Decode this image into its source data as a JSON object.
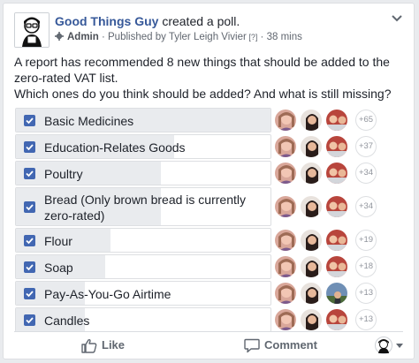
{
  "post": {
    "page_name": "Good Things Guy",
    "action": " created a poll.",
    "admin_label": "Admin",
    "published_text": " · Published by Tyler Leigh Vivier",
    "superscript": " [?]",
    "time": " · 38 mins",
    "text": "A report has recommended 8 new things that should be added to the zero-rated VAT list.\nWhich ones do you think should be added? And what is still missing?"
  },
  "poll": {
    "options": [
      {
        "label": "Basic Medicines",
        "more": "+65",
        "fill": 1.0,
        "checked": true
      },
      {
        "label": "Education-Relates Goods",
        "more": "+37",
        "fill": 0.62,
        "checked": true
      },
      {
        "label": "Poultry",
        "more": "+34",
        "fill": 0.57,
        "checked": true
      },
      {
        "label": "Bread (Only brown bread is currently zero-rated)",
        "more": "+34",
        "fill": 0.57,
        "checked": true
      },
      {
        "label": "Flour",
        "more": "+19",
        "fill": 0.37,
        "checked": true
      },
      {
        "label": "Soap",
        "more": "+18",
        "fill": 0.35,
        "checked": true
      },
      {
        "label": "Pay-As-You-Go Airtime",
        "more": "+13",
        "fill": 0.27,
        "checked": true
      },
      {
        "label": "Candles",
        "more": "+13",
        "fill": 0.27,
        "checked": true
      }
    ]
  },
  "actions": {
    "like": "Like",
    "comment": "Comment"
  },
  "colors": {
    "link": "#365899",
    "checkbox": "#4267b2",
    "bar": "#e9ebee"
  },
  "icons": [
    "page-logo-icon",
    "chevron-down-icon",
    "gear-icon",
    "check-icon",
    "like-icon",
    "comment-icon",
    "viewer-avatar-icon",
    "caret-down-icon"
  ]
}
